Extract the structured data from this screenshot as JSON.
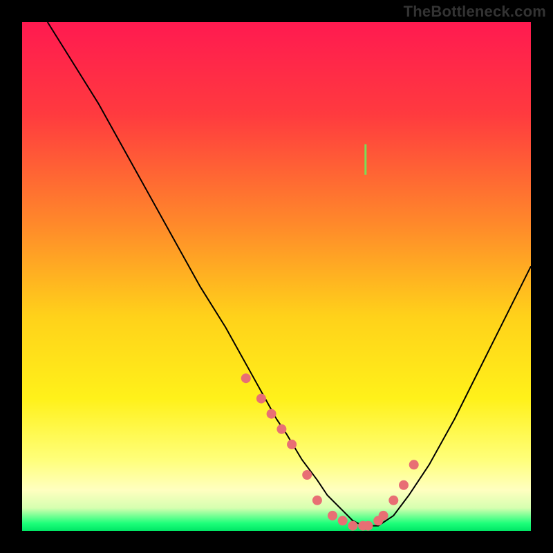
{
  "watermark": "TheBottleneck.com",
  "chart_data": {
    "type": "line",
    "title": "",
    "xlabel": "",
    "ylabel": "",
    "xlim": [
      0,
      100
    ],
    "ylim": [
      0,
      100
    ],
    "background_gradient": {
      "stops": [
        {
          "offset": 0.0,
          "color": "#ff1a50"
        },
        {
          "offset": 0.18,
          "color": "#ff3a3f"
        },
        {
          "offset": 0.4,
          "color": "#ff8a2a"
        },
        {
          "offset": 0.58,
          "color": "#ffd21a"
        },
        {
          "offset": 0.74,
          "color": "#fff11a"
        },
        {
          "offset": 0.86,
          "color": "#ffff7a"
        },
        {
          "offset": 0.92,
          "color": "#ffffc0"
        },
        {
          "offset": 0.955,
          "color": "#d6ffb0"
        },
        {
          "offset": 0.985,
          "color": "#1dff7a"
        },
        {
          "offset": 1.0,
          "color": "#00e665"
        }
      ]
    },
    "annotations": {
      "green_tick": {
        "x": 67.5,
        "y_top": 70,
        "y_bottom": 76
      }
    },
    "series": [
      {
        "name": "curve",
        "stroke": "#000000",
        "stroke_width": 2,
        "x": [
          5,
          10,
          15,
          20,
          25,
          30,
          35,
          40,
          45,
          50,
          52,
          55,
          58,
          60,
          63,
          65,
          67,
          68,
          70,
          73,
          76,
          80,
          85,
          90,
          95,
          100
        ],
        "values": [
          100,
          92,
          84,
          75,
          66,
          57,
          48,
          40,
          31,
          22,
          19,
          14,
          10,
          7,
          4,
          2,
          1,
          1,
          1,
          3,
          7,
          13,
          22,
          32,
          42,
          52
        ]
      },
      {
        "name": "dots",
        "type": "scatter",
        "marker_color": "#e86f74",
        "marker_radius": 7,
        "x": [
          44,
          47,
          49,
          51,
          53,
          56,
          58,
          61,
          63,
          65,
          67,
          68,
          70,
          71,
          73,
          75,
          77
        ],
        "values": [
          30,
          26,
          23,
          20,
          17,
          11,
          6,
          3,
          2,
          1,
          1,
          1,
          2,
          3,
          6,
          9,
          13
        ]
      }
    ]
  }
}
